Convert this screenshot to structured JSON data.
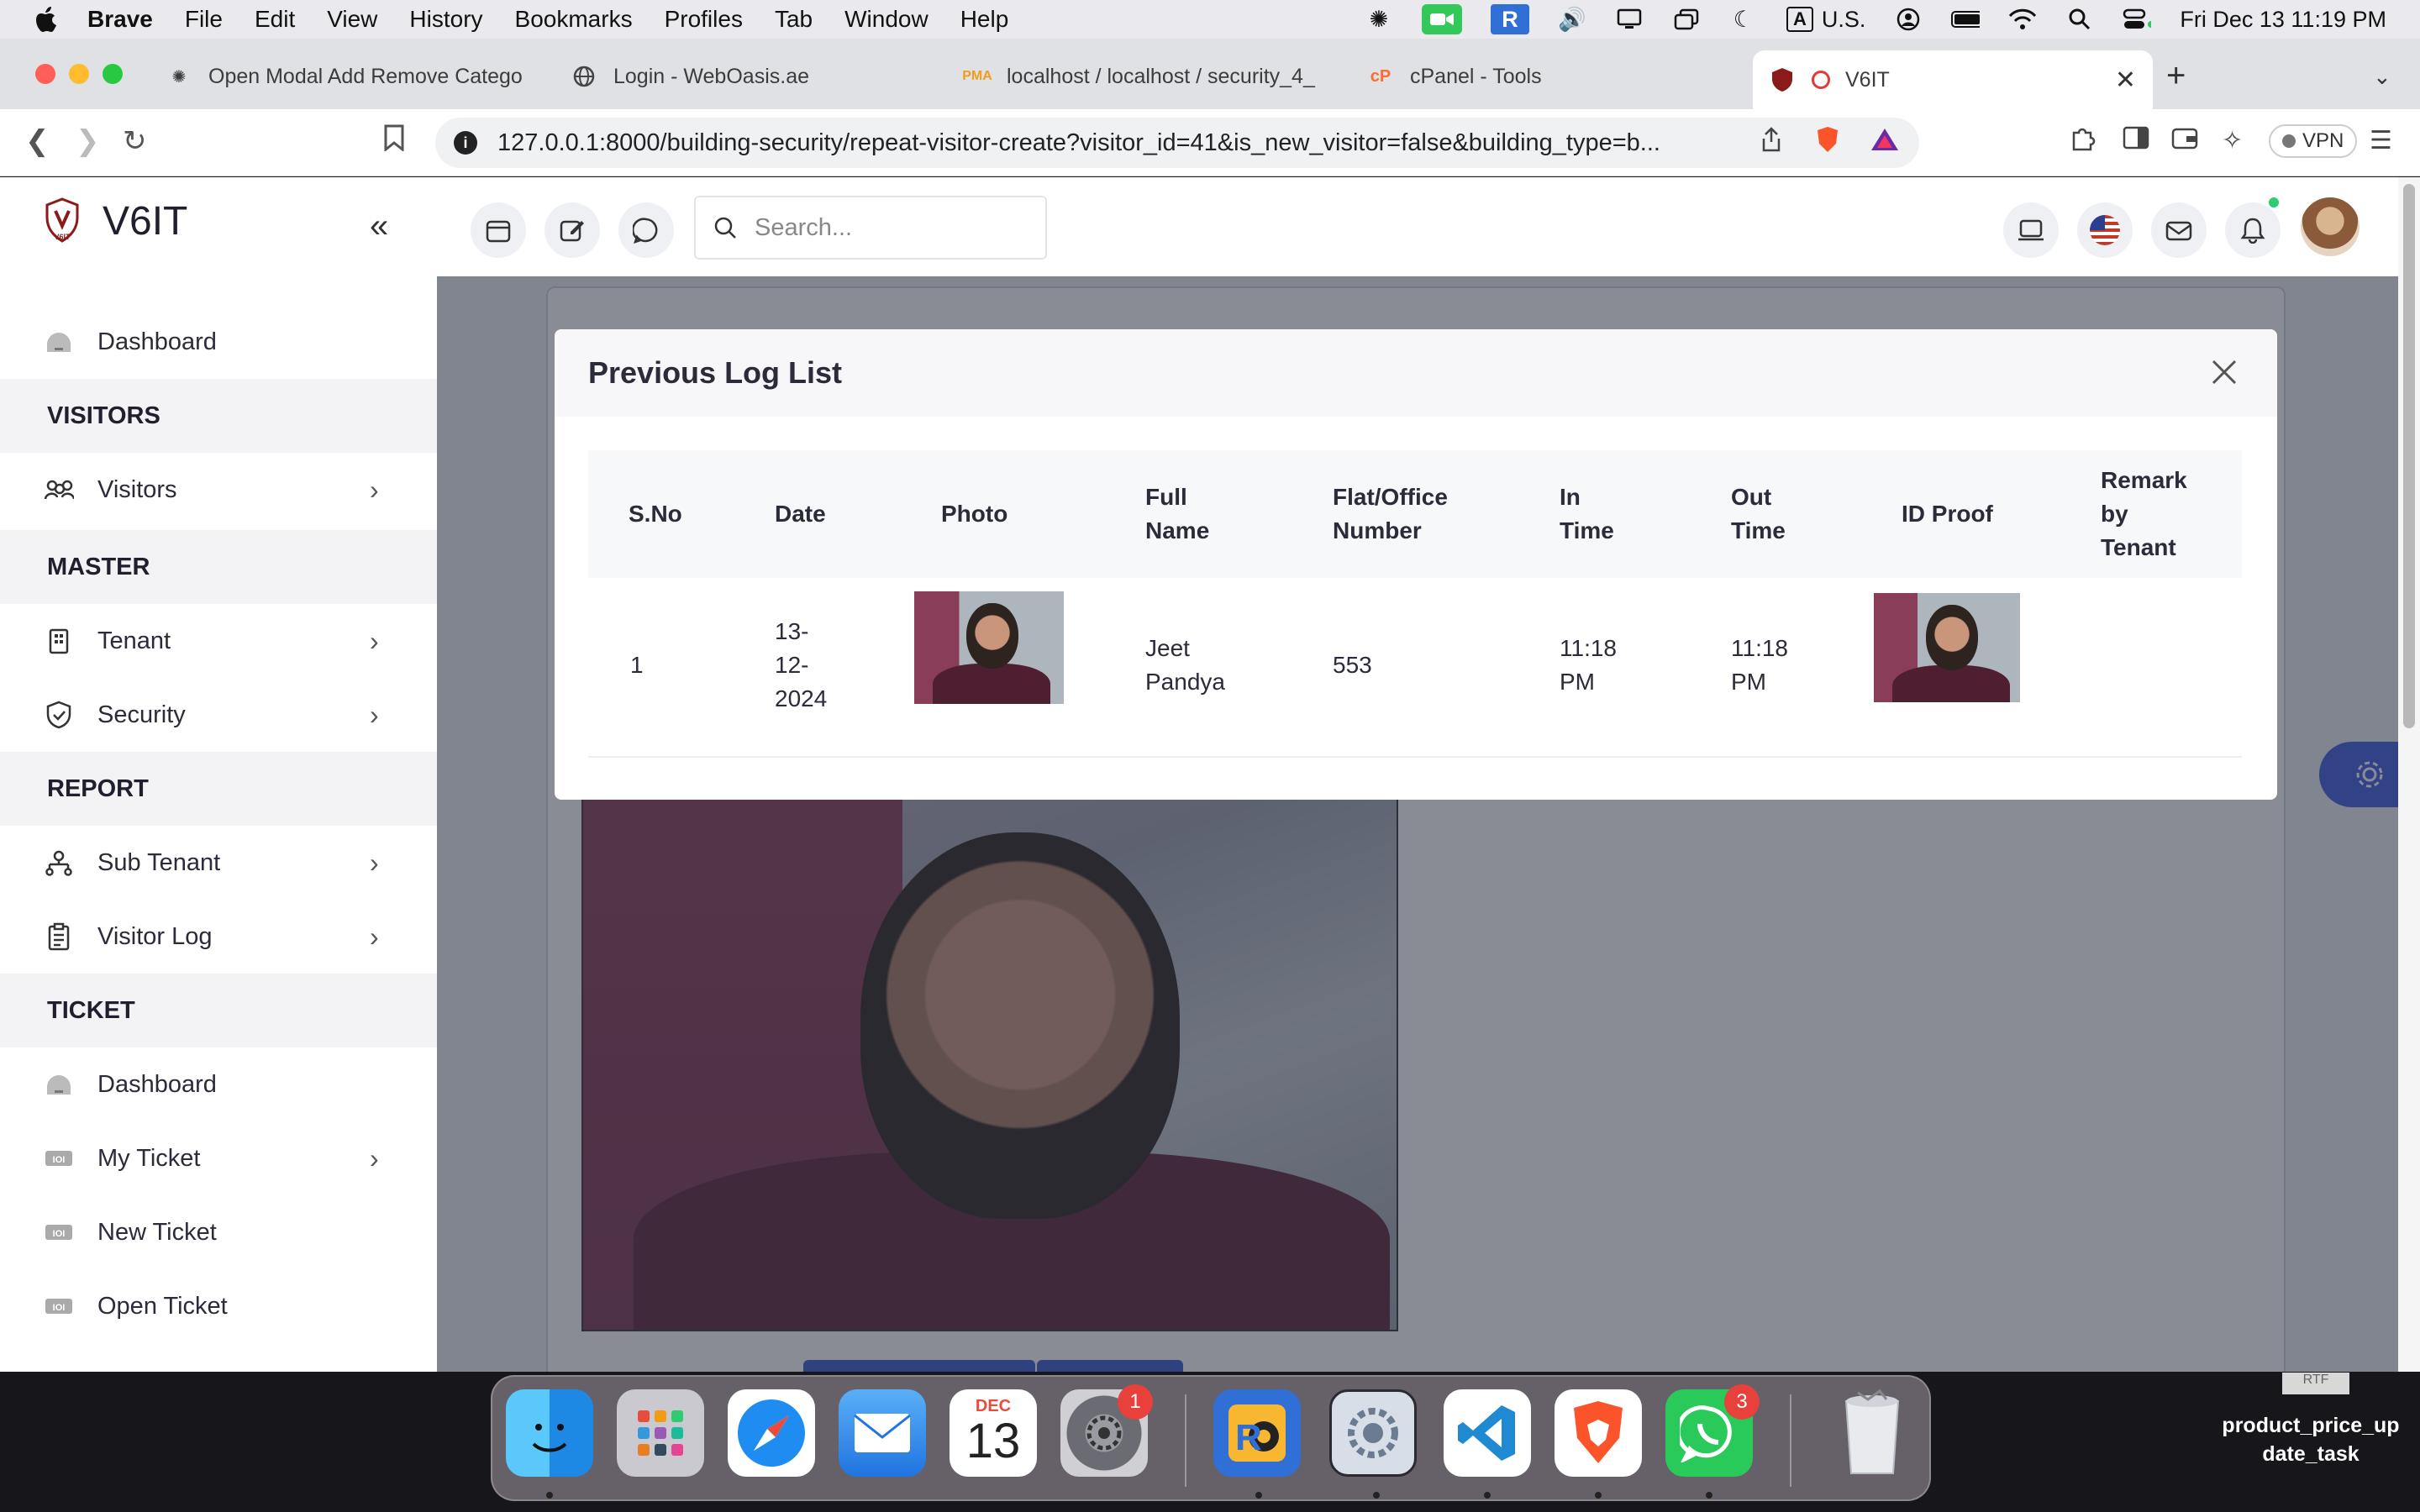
{
  "menubar": {
    "app": "Brave",
    "items": [
      "File",
      "Edit",
      "View",
      "History",
      "Bookmarks",
      "Profiles",
      "Tab",
      "Window",
      "Help"
    ],
    "input_source": "A",
    "input_label": "U.S.",
    "datetime": "Fri Dec 13  11:19 PM"
  },
  "tabs": [
    {
      "title": "Open Modal Add Remove Catego",
      "icon": "openai-icon"
    },
    {
      "title": "Login - WebOasis.ae",
      "icon": "globe-icon"
    },
    {
      "title": "localhost / localhost / security_4_",
      "icon": "phpmyadmin-icon"
    },
    {
      "title": "cPanel - Tools",
      "icon": "cpanel-icon"
    },
    {
      "title": "V6IT",
      "icon": "v6it-icon"
    }
  ],
  "toolbar": {
    "url": "127.0.0.1:8000/building-security/repeat-visitor-create?visitor_id=41&is_new_visitor=false&building_type=b...",
    "vpn_label": "VPN"
  },
  "sidebar": {
    "brand": "V6IT",
    "items": [
      {
        "type": "item",
        "label": "Dashboard",
        "icon": "dashboard-icon",
        "chevron": false
      },
      {
        "type": "section",
        "label": "VISITORS"
      },
      {
        "type": "item",
        "label": "Visitors",
        "icon": "users-icon",
        "chevron": true
      },
      {
        "type": "section",
        "label": "MASTER"
      },
      {
        "type": "item",
        "label": "Tenant",
        "icon": "building-icon",
        "chevron": true
      },
      {
        "type": "item",
        "label": "Security",
        "icon": "shield-icon",
        "chevron": true
      },
      {
        "type": "section",
        "label": "REPORT"
      },
      {
        "type": "item",
        "label": "Sub Tenant",
        "icon": "user-tree-icon",
        "chevron": true
      },
      {
        "type": "item",
        "label": "Visitor Log",
        "icon": "clipboard-icon",
        "chevron": true
      },
      {
        "type": "section",
        "label": "TICKET"
      },
      {
        "type": "item",
        "label": "Dashboard",
        "icon": "dashboard-icon",
        "chevron": false
      },
      {
        "type": "item",
        "label": "My Ticket",
        "icon": "ticket-icon",
        "chevron": true
      },
      {
        "type": "item",
        "label": "New Ticket",
        "icon": "ticket-icon",
        "chevron": false
      },
      {
        "type": "item",
        "label": "Open Ticket",
        "icon": "ticket-icon",
        "chevron": false
      }
    ]
  },
  "topbar": {
    "search_placeholder": "Search..."
  },
  "modal": {
    "title": "Previous Log List",
    "columns": [
      "S.No",
      "Date",
      "Photo",
      "Full\nName",
      "Flat/Office\nNumber",
      "In\nTime",
      "Out\nTime",
      "ID Proof",
      "Remark\nby\nTenant"
    ],
    "rows": [
      {
        "sno": "1",
        "date": "13-\n12-\n2024",
        "full_name": "Jeet\nPandya",
        "flat": "553",
        "in_time": "11:18\nPM",
        "out_time": "11:18\nPM",
        "remark": ""
      }
    ]
  },
  "dock": {
    "calendar_month": "DEC",
    "calendar_day": "13",
    "settings_badge": "1",
    "whatsapp_badge": "3"
  },
  "desktop": {
    "file_tag": "RTF",
    "file_name": "product_price_up\ndate_task"
  }
}
